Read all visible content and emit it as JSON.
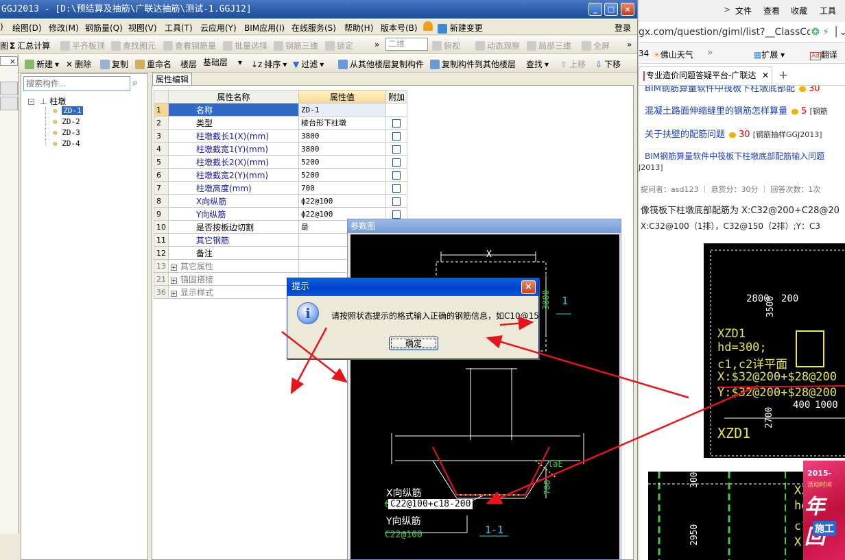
{
  "app": {
    "title": "GGJ2013 - [D:\\预结算及抽筋\\广联达抽筋\\测试-1.GGJ12]",
    "login": "登录",
    "menus": [
      "绘图(D)",
      "修改(M)",
      "钢筋量(Q)",
      "视图(V)",
      "工具(T)",
      "云应用(Y)",
      "BIM应用(I)",
      "在线服务(S)",
      "帮助(H)",
      "版本号(B)",
      "新建变更"
    ],
    "menu_prefix": ")",
    "toolbar1": {
      "sigma": "Σ",
      "calc": "汇总计算",
      "items": [
        "平齐板顶",
        "查找图元",
        "查看钢筋量",
        "批量选择",
        "钢筋三维",
        "锁定"
      ],
      "view_combo": "二维",
      "view_items": [
        "俯视",
        "动态观察",
        "局部三维",
        "全屏"
      ],
      "more": "»"
    },
    "toolbar2": {
      "items": [
        "新建",
        "删除",
        "复制",
        "重命名"
      ],
      "floor_label": "楼层",
      "floor_value": "基础层",
      "items2": [
        "排序",
        "过滤",
        "从其他楼层复制构件",
        "复制构件到其他楼层",
        "查找",
        "上移",
        "下移"
      ]
    },
    "left_strip": {
      "a": "×",
      "b": "图"
    },
    "search_placeholder": "搜索构件...",
    "tree": {
      "root": "柱墩",
      "items": [
        "ZD-1",
        "ZD-2",
        "ZD-3",
        "ZD-4"
      ],
      "selected": "ZD-1"
    },
    "tab_label": "属性编辑",
    "grid": {
      "headers": [
        "属性名称",
        "属性值",
        "附加"
      ],
      "rows": [
        {
          "n": "1",
          "name": "名称",
          "value": "ZD-1",
          "check": false,
          "blue": false
        },
        {
          "n": "2",
          "name": "类型",
          "value": "棱台形下柱墩",
          "check": true,
          "blue": false
        },
        {
          "n": "3",
          "name": "柱墩截长1(X)(mm)",
          "value": "3800",
          "check": true,
          "blue": true
        },
        {
          "n": "4",
          "name": "柱墩截宽1(Y)(mm)",
          "value": "3800",
          "check": true,
          "blue": true
        },
        {
          "n": "5",
          "name": "柱墩截长2(X)(mm)",
          "value": "5200",
          "check": true,
          "blue": true
        },
        {
          "n": "6",
          "name": "柱墩截宽2(Y)(mm)",
          "value": "5200",
          "check": true,
          "blue": true
        },
        {
          "n": "7",
          "name": "柱墩高度(mm)",
          "value": "700",
          "check": true,
          "blue": true
        },
        {
          "n": "8",
          "name": "X向纵筋",
          "value": "ф22@100",
          "check": true,
          "blue": true
        },
        {
          "n": "9",
          "name": "Y向纵筋",
          "value": "ф22@100",
          "check": true,
          "blue": true
        },
        {
          "n": "10",
          "name": "是否按板边切割",
          "value": "是",
          "check": false,
          "blue": false
        },
        {
          "n": "11",
          "name": "其它钢筋",
          "value": "",
          "check": false,
          "blue": true
        },
        {
          "n": "12",
          "name": "备注",
          "value": "",
          "check": false,
          "blue": false
        },
        {
          "n": "13",
          "name": "其它属性",
          "value": "",
          "check": false,
          "blue": false,
          "group": true
        },
        {
          "n": "21",
          "name": "锚固搭接",
          "value": "",
          "check": false,
          "blue": false,
          "group": true
        },
        {
          "n": "36",
          "name": "显示样式",
          "value": "",
          "check": false,
          "blue": false,
          "group": true
        }
      ]
    }
  },
  "param_window": {
    "title": "参数图",
    "dim_x": "X",
    "dim_3800": "3800",
    "section_1": "1",
    "dim_700": "700",
    "dim_lae": "laE",
    "x_rebar_label": "X向纵筋",
    "x_rebar_input": "C22@100+c18-200",
    "x_rebar_prefix": "C",
    "y_rebar_label": "Y向纵筋",
    "y_rebar_value": "C22@100",
    "section_11": "1-1"
  },
  "dialog": {
    "title": "提示",
    "icon": "i",
    "close": "×",
    "message": "请按照状态提示的格式输入正确的钢筋信息，如C10@150",
    "ok": "确定"
  },
  "browser": {
    "menus": [
      "文件",
      "查看",
      "收藏",
      "工具"
    ],
    "url": "gx.com/question/giml/list?__ClassCod",
    "fav_num": "34",
    "fav_weather": "佛山天气",
    "fav_more": "»",
    "fav_ext": "扩展",
    "fav_translate": "翻译",
    "tab_title": "专业造价问题答疑平台-广联达",
    "tab_new": "+",
    "links": [
      {
        "text": "BIM钢筋算量软件中筏板下柱墩底部配",
        "coin": "30",
        "tag": ""
      },
      {
        "text": "混凝土路面伸缩缝里的钢筋怎样算量",
        "coin": "5",
        "tag": "[钢筋"
      },
      {
        "text": "关于扶壁的配筋问题",
        "coin": "30",
        "tag": "[钢筋抽样GGJ2013]"
      },
      {
        "text": "BIM钢筋算量软件中筏板下柱墩底部配筋输入问题",
        "coin": "",
        "tag": ""
      }
    ],
    "link4_tail": "J2013]",
    "meta": "提问者：asd123  ｜  悬赏分：30分  ｜  回答次数：1次",
    "q1": "像筏板下柱墩底部配筋为 X:C32@200+C28@20",
    "q2": "X:C32@100（1排），C32@150（2排）;Y：C3",
    "cad1": {
      "t2800": "2800",
      "t200": "200",
      "t3500": "3500",
      "xzd1": "XZD1",
      "hd": "hd=300;",
      "c1c2": "c1,c2详平面",
      "x": "X:$32@200+$28@200",
      "y": "Y:$32@200+$28@200",
      "t400": "400",
      "t1000": "1000",
      "t2700": "2700",
      "xzd1b": "XZD1"
    },
    "cad2": {
      "t300": "300",
      "t2950": "2950",
      "xz": "XZ",
      "hd": "hd=",
      "c1": "c1,",
      "x": "X:$"
    },
    "ad": {
      "year": "2015-",
      "line1": "活动时间",
      "big": "年回",
      "small": "施工"
    }
  },
  "colors": {
    "accent_red": "#e8141c",
    "cad_yellow": "#e8e84a",
    "selection_blue": "#3169c6"
  }
}
